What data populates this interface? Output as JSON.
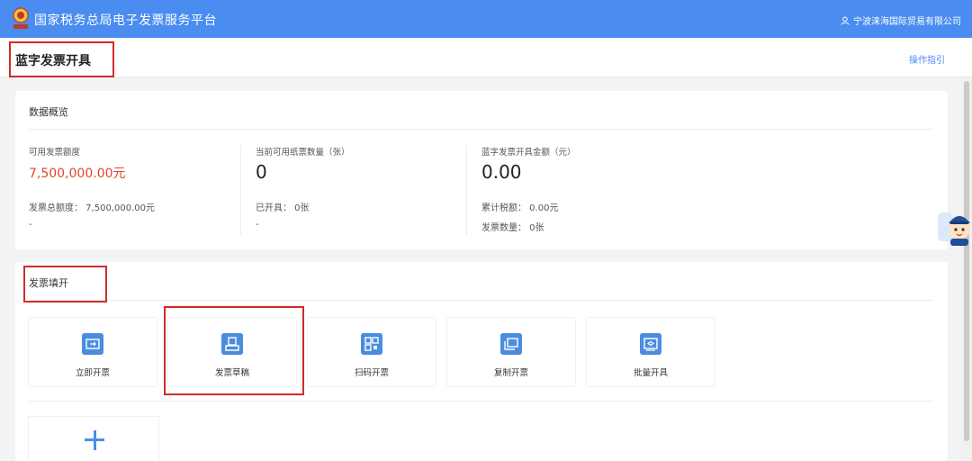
{
  "header": {
    "app_title": "国家税务总局电子发票服务平台",
    "user_company": "宁波涞海国际贸易有限公司",
    "icons": {
      "logo": "tax-emblem-icon",
      "user": "user-icon"
    }
  },
  "page": {
    "title": "蓝字发票开具",
    "guide_link": "操作指引"
  },
  "overview": {
    "title": "数据概览",
    "col1": {
      "label": "可用发票额度",
      "value": "7,500,000.00元",
      "sub1": "发票总额度： 7,500,000.00元",
      "sub2": "-"
    },
    "col2": {
      "label": "当前可用纸票数量（张）",
      "value": "0",
      "sub1": "已开具： 0张",
      "sub2": "-"
    },
    "col3": {
      "label": "蓝字发票开具金额（元）",
      "value": "0.00",
      "sub1": "累计税额： 0.00元",
      "sub2": "发票数量： 0张"
    }
  },
  "fill": {
    "title": "发票填开",
    "tiles": [
      {
        "label": "立即开票",
        "icon": "invoice-now-icon"
      },
      {
        "label": "发票草稿",
        "icon": "draft-icon"
      },
      {
        "label": "扫码开票",
        "icon": "qr-code-icon"
      },
      {
        "label": "复制开票",
        "icon": "copy-invoice-icon"
      },
      {
        "label": "批量开具",
        "icon": "batch-invoice-icon"
      }
    ],
    "add_icon": "plus-icon"
  },
  "colors": {
    "brand": "#4a8cf0",
    "highlight_box": "#d22b2b",
    "amount_red": "#e0452b"
  }
}
